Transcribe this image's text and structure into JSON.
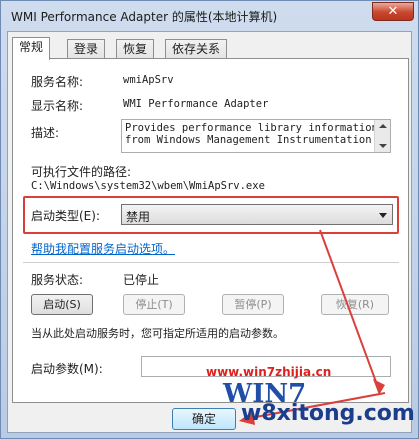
{
  "window": {
    "title": "WMI Performance Adapter 的属性(本地计算机)",
    "close_label": "✕"
  },
  "tabs": [
    {
      "label": "常规"
    },
    {
      "label": "登录"
    },
    {
      "label": "恢复"
    },
    {
      "label": "依存关系"
    }
  ],
  "general": {
    "service_name_label": "服务名称:",
    "service_name_value": "wmiApSrv",
    "display_name_label": "显示名称:",
    "display_name_value": "WMI Performance Adapter",
    "description_label": "描述:",
    "description_line1": "Provides performance library information",
    "description_line2": "from Windows Management Instrumentation",
    "exe_path_label": "可执行文件的路径:",
    "exe_path_value": "C:\\Windows\\system32\\wbem\\WmiApSrv.exe",
    "startup_type_label": "启动类型(E):",
    "startup_type_value": "禁用",
    "help_link": "帮助我配置服务启动选项。",
    "status_label": "服务状态:",
    "status_value": "已停止",
    "buttons": {
      "start": "启动(S)",
      "stop": "停止(T)",
      "pause": "暂停(P)",
      "resume": "恢复(R)"
    },
    "hint": "当从此处启动服务时，您可指定所适用的启动参数。",
    "start_params_label": "启动参数(M):",
    "start_params_value": ""
  },
  "footer": {
    "ok_label": "确定"
  },
  "watermark": {
    "url": "www.win7zhijia.cn",
    "logo_main": "WIN7",
    "logo_sub": "w8xitong.com"
  }
}
